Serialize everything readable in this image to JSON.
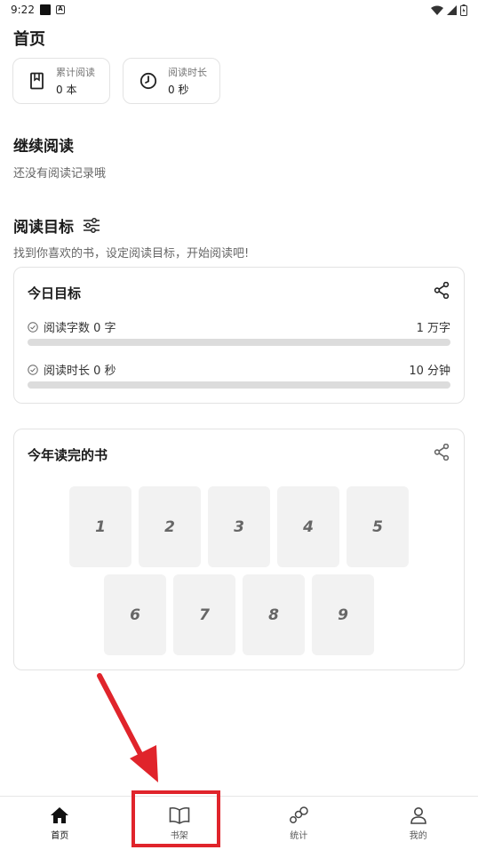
{
  "status": {
    "time": "9:22"
  },
  "page": {
    "title": "首页"
  },
  "stats": [
    {
      "label": "累计阅读",
      "value": "0 本",
      "icon": "book-icon"
    },
    {
      "label": "阅读时长",
      "value": "0 秒",
      "icon": "clock-icon"
    }
  ],
  "continue": {
    "title": "继续阅读",
    "empty_text": "还没有阅读记录哦"
  },
  "goals": {
    "title": "阅读目标",
    "subtitle": "找到你喜欢的书，设定阅读目标，开始阅读吧!"
  },
  "today": {
    "title": "今日目标",
    "rows": [
      {
        "label": "阅读字数 0 字",
        "target": "1 万字",
        "progress": 0
      },
      {
        "label": "阅读时长 0 秒",
        "target": "10 分钟",
        "progress": 0
      }
    ]
  },
  "year": {
    "title": "今年读完的书",
    "books": [
      "1",
      "2",
      "3",
      "4",
      "5",
      "6",
      "7",
      "8",
      "9"
    ]
  },
  "tabs": [
    {
      "label": "首页",
      "icon": "home-icon"
    },
    {
      "label": "书架",
      "icon": "open-book-icon"
    },
    {
      "label": "统计",
      "icon": "stats-icon"
    },
    {
      "label": "我的",
      "icon": "person-icon"
    }
  ],
  "colors": {
    "highlight": "#e0242b",
    "track": "#dcdcdc"
  }
}
